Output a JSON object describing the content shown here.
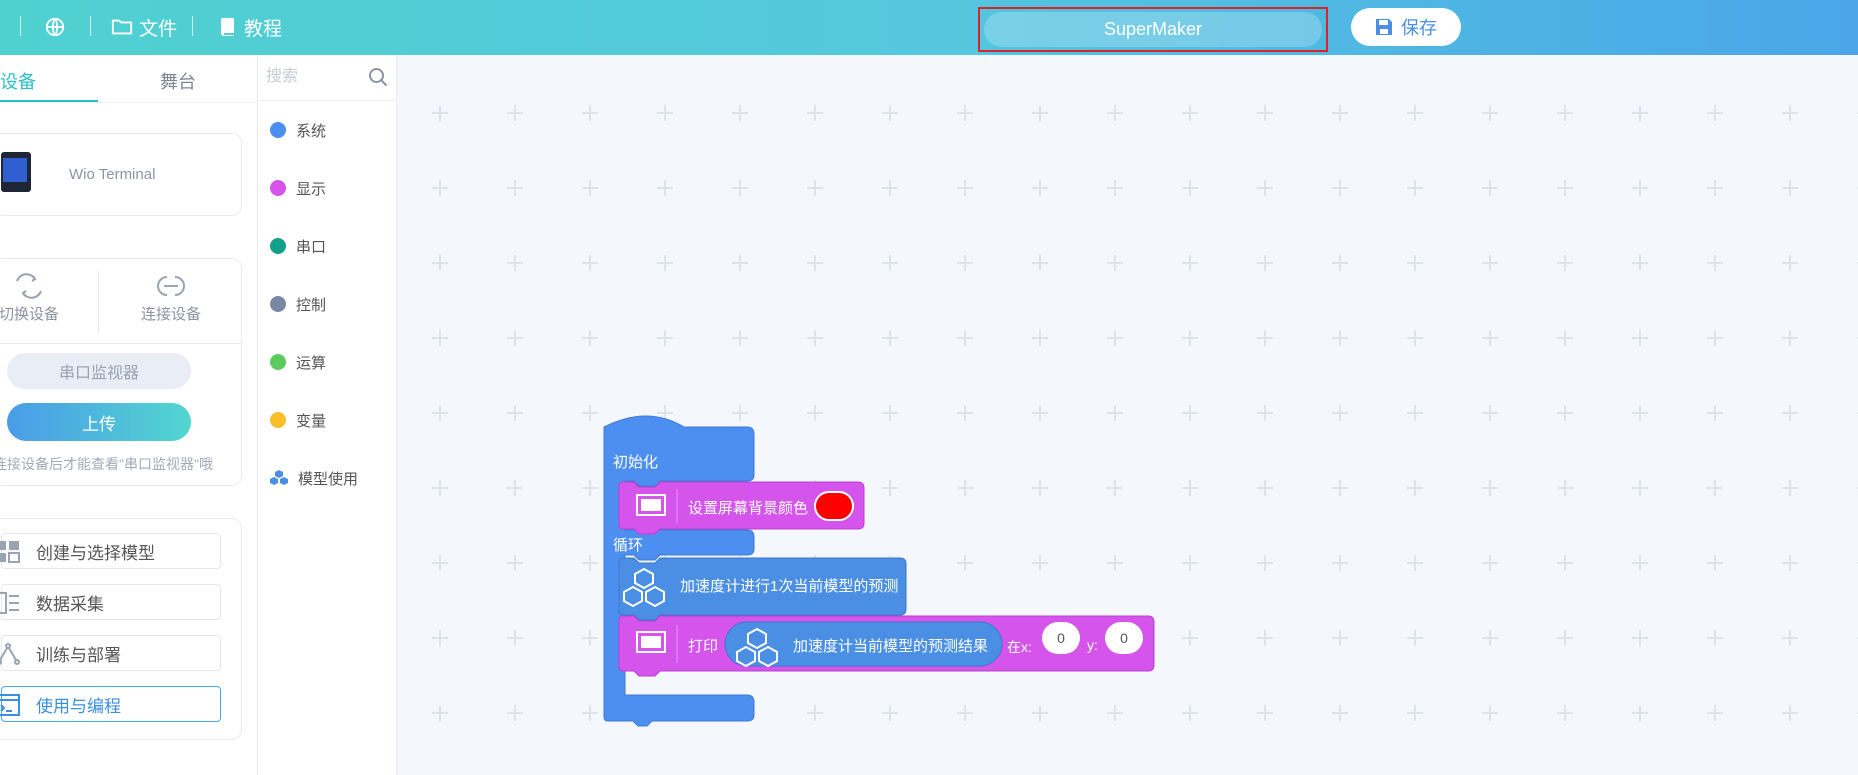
{
  "topbar": {
    "file_label": "文件",
    "tutorial_label": "教程",
    "project_name": "SuperMaker",
    "save_label": "保存"
  },
  "left": {
    "tabs": [
      "设备",
      "舞台"
    ],
    "device_name": "Wio Terminal",
    "switch_label": "切换设备",
    "connect_label": "连接设备",
    "serial_monitor_label": "串口监视器",
    "upload_label": "上传",
    "hint": "连接设备后才能查看\"串口监视器\"哦",
    "steps": [
      "创建与选择模型",
      "数据采集",
      "训练与部署",
      "使用与编程"
    ]
  },
  "categories": {
    "search_placeholder": "搜索",
    "items": [
      {
        "label": "系统",
        "color": "#4d8ff0"
      },
      {
        "label": "显示",
        "color": "#d454ec"
      },
      {
        "label": "串口",
        "color": "#13a08a"
      },
      {
        "label": "控制",
        "color": "#7a87a5"
      },
      {
        "label": "运算",
        "color": "#5ccb5f"
      },
      {
        "label": "变量",
        "color": "#f8bf2b"
      },
      {
        "label": "模型使用",
        "color": "#4a8fe4"
      }
    ]
  },
  "blocks": {
    "init_label": "初始化",
    "set_bg_label": "设置屏幕背景颜色",
    "bg_color": "#ff0000",
    "loop_label": "循环",
    "predict_label": "加速度计进行1次当前模型的预测",
    "print_label": "打印",
    "result_label": "加速度计当前模型的预测结果",
    "at_x_label": "在x:",
    "x_value": "0",
    "y_label": "y:",
    "y_value": "0"
  }
}
